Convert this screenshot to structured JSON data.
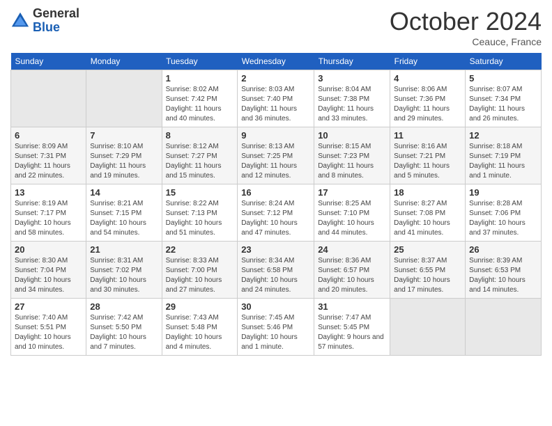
{
  "header": {
    "logo_general": "General",
    "logo_blue": "Blue",
    "month_title": "October 2024",
    "location": "Ceauce, France"
  },
  "days_of_week": [
    "Sunday",
    "Monday",
    "Tuesday",
    "Wednesday",
    "Thursday",
    "Friday",
    "Saturday"
  ],
  "weeks": [
    [
      {
        "day": "",
        "empty": true
      },
      {
        "day": "",
        "empty": true
      },
      {
        "day": "1",
        "sunrise": "Sunrise: 8:02 AM",
        "sunset": "Sunset: 7:42 PM",
        "daylight": "Daylight: 11 hours and 40 minutes."
      },
      {
        "day": "2",
        "sunrise": "Sunrise: 8:03 AM",
        "sunset": "Sunset: 7:40 PM",
        "daylight": "Daylight: 11 hours and 36 minutes."
      },
      {
        "day": "3",
        "sunrise": "Sunrise: 8:04 AM",
        "sunset": "Sunset: 7:38 PM",
        "daylight": "Daylight: 11 hours and 33 minutes."
      },
      {
        "day": "4",
        "sunrise": "Sunrise: 8:06 AM",
        "sunset": "Sunset: 7:36 PM",
        "daylight": "Daylight: 11 hours and 29 minutes."
      },
      {
        "day": "5",
        "sunrise": "Sunrise: 8:07 AM",
        "sunset": "Sunset: 7:34 PM",
        "daylight": "Daylight: 11 hours and 26 minutes."
      }
    ],
    [
      {
        "day": "6",
        "sunrise": "Sunrise: 8:09 AM",
        "sunset": "Sunset: 7:31 PM",
        "daylight": "Daylight: 11 hours and 22 minutes."
      },
      {
        "day": "7",
        "sunrise": "Sunrise: 8:10 AM",
        "sunset": "Sunset: 7:29 PM",
        "daylight": "Daylight: 11 hours and 19 minutes."
      },
      {
        "day": "8",
        "sunrise": "Sunrise: 8:12 AM",
        "sunset": "Sunset: 7:27 PM",
        "daylight": "Daylight: 11 hours and 15 minutes."
      },
      {
        "day": "9",
        "sunrise": "Sunrise: 8:13 AM",
        "sunset": "Sunset: 7:25 PM",
        "daylight": "Daylight: 11 hours and 12 minutes."
      },
      {
        "day": "10",
        "sunrise": "Sunrise: 8:15 AM",
        "sunset": "Sunset: 7:23 PM",
        "daylight": "Daylight: 11 hours and 8 minutes."
      },
      {
        "day": "11",
        "sunrise": "Sunrise: 8:16 AM",
        "sunset": "Sunset: 7:21 PM",
        "daylight": "Daylight: 11 hours and 5 minutes."
      },
      {
        "day": "12",
        "sunrise": "Sunrise: 8:18 AM",
        "sunset": "Sunset: 7:19 PM",
        "daylight": "Daylight: 11 hours and 1 minute."
      }
    ],
    [
      {
        "day": "13",
        "sunrise": "Sunrise: 8:19 AM",
        "sunset": "Sunset: 7:17 PM",
        "daylight": "Daylight: 10 hours and 58 minutes."
      },
      {
        "day": "14",
        "sunrise": "Sunrise: 8:21 AM",
        "sunset": "Sunset: 7:15 PM",
        "daylight": "Daylight: 10 hours and 54 minutes."
      },
      {
        "day": "15",
        "sunrise": "Sunrise: 8:22 AM",
        "sunset": "Sunset: 7:13 PM",
        "daylight": "Daylight: 10 hours and 51 minutes."
      },
      {
        "day": "16",
        "sunrise": "Sunrise: 8:24 AM",
        "sunset": "Sunset: 7:12 PM",
        "daylight": "Daylight: 10 hours and 47 minutes."
      },
      {
        "day": "17",
        "sunrise": "Sunrise: 8:25 AM",
        "sunset": "Sunset: 7:10 PM",
        "daylight": "Daylight: 10 hours and 44 minutes."
      },
      {
        "day": "18",
        "sunrise": "Sunrise: 8:27 AM",
        "sunset": "Sunset: 7:08 PM",
        "daylight": "Daylight: 10 hours and 41 minutes."
      },
      {
        "day": "19",
        "sunrise": "Sunrise: 8:28 AM",
        "sunset": "Sunset: 7:06 PM",
        "daylight": "Daylight: 10 hours and 37 minutes."
      }
    ],
    [
      {
        "day": "20",
        "sunrise": "Sunrise: 8:30 AM",
        "sunset": "Sunset: 7:04 PM",
        "daylight": "Daylight: 10 hours and 34 minutes."
      },
      {
        "day": "21",
        "sunrise": "Sunrise: 8:31 AM",
        "sunset": "Sunset: 7:02 PM",
        "daylight": "Daylight: 10 hours and 30 minutes."
      },
      {
        "day": "22",
        "sunrise": "Sunrise: 8:33 AM",
        "sunset": "Sunset: 7:00 PM",
        "daylight": "Daylight: 10 hours and 27 minutes."
      },
      {
        "day": "23",
        "sunrise": "Sunrise: 8:34 AM",
        "sunset": "Sunset: 6:58 PM",
        "daylight": "Daylight: 10 hours and 24 minutes."
      },
      {
        "day": "24",
        "sunrise": "Sunrise: 8:36 AM",
        "sunset": "Sunset: 6:57 PM",
        "daylight": "Daylight: 10 hours and 20 minutes."
      },
      {
        "day": "25",
        "sunrise": "Sunrise: 8:37 AM",
        "sunset": "Sunset: 6:55 PM",
        "daylight": "Daylight: 10 hours and 17 minutes."
      },
      {
        "day": "26",
        "sunrise": "Sunrise: 8:39 AM",
        "sunset": "Sunset: 6:53 PM",
        "daylight": "Daylight: 10 hours and 14 minutes."
      }
    ],
    [
      {
        "day": "27",
        "sunrise": "Sunrise: 7:40 AM",
        "sunset": "Sunset: 5:51 PM",
        "daylight": "Daylight: 10 hours and 10 minutes."
      },
      {
        "day": "28",
        "sunrise": "Sunrise: 7:42 AM",
        "sunset": "Sunset: 5:50 PM",
        "daylight": "Daylight: 10 hours and 7 minutes."
      },
      {
        "day": "29",
        "sunrise": "Sunrise: 7:43 AM",
        "sunset": "Sunset: 5:48 PM",
        "daylight": "Daylight: 10 hours and 4 minutes."
      },
      {
        "day": "30",
        "sunrise": "Sunrise: 7:45 AM",
        "sunset": "Sunset: 5:46 PM",
        "daylight": "Daylight: 10 hours and 1 minute."
      },
      {
        "day": "31",
        "sunrise": "Sunrise: 7:47 AM",
        "sunset": "Sunset: 5:45 PM",
        "daylight": "Daylight: 9 hours and 57 minutes."
      },
      {
        "day": "",
        "empty": true
      },
      {
        "day": "",
        "empty": true
      }
    ]
  ]
}
